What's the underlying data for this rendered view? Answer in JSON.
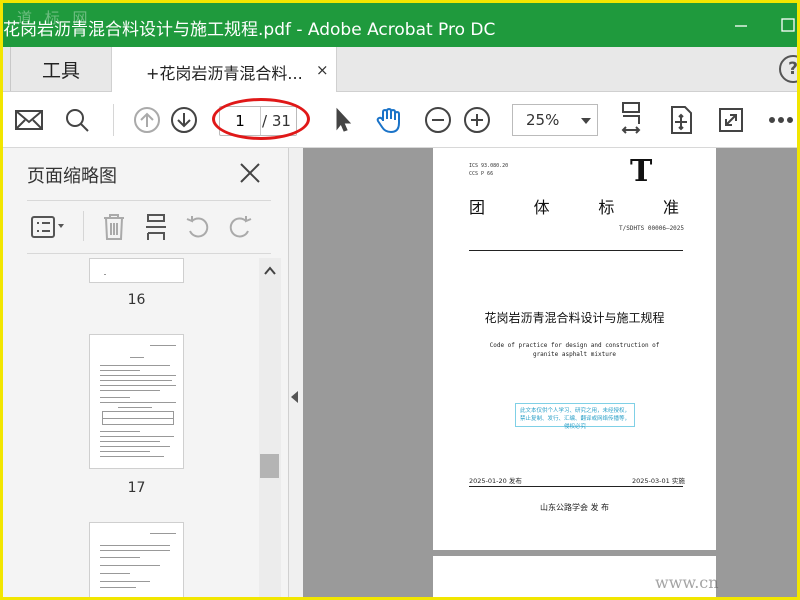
{
  "window": {
    "title": "花岗岩沥青混合料设计与施工规程.pdf - Adobe Acrobat Pro DC",
    "watermark_top": "道 标 网"
  },
  "tabs": {
    "tools_label": "工具",
    "doc_label": "+花岗岩沥青混合料...",
    "close_glyph": "×",
    "help_glyph": "?"
  },
  "toolbar": {
    "page_current": "1",
    "page_total": "/ 31",
    "zoom": "25%"
  },
  "sidepanel": {
    "title": "页面缩略图",
    "thumbs": [
      {
        "label": "16"
      },
      {
        "label": "17"
      }
    ]
  },
  "document": {
    "ics_code": "ICS  93.080.20",
    "ccs_code": "CCS  P 66",
    "big_letter": "T",
    "standard_chars": [
      "团",
      "体",
      "标",
      "准"
    ],
    "doc_number": "T/SDHTS 00006—2025",
    "title_cn": "花岗岩沥青混合料设计与施工规程",
    "title_en_line1": "Code of practice for design  and construction of",
    "title_en_line2": "granite asphalt mixture",
    "notice": "此文本仅供个人学习、研究之用，未经授权，禁止复制、发行、汇编、翻译或网络传播等，侵权必究",
    "publish_date": "2025-01-20 发布",
    "implement_date": "2025-03-01 实施",
    "publisher": "山东公路学会   发 布"
  },
  "watermark_url": "www.cn"
}
